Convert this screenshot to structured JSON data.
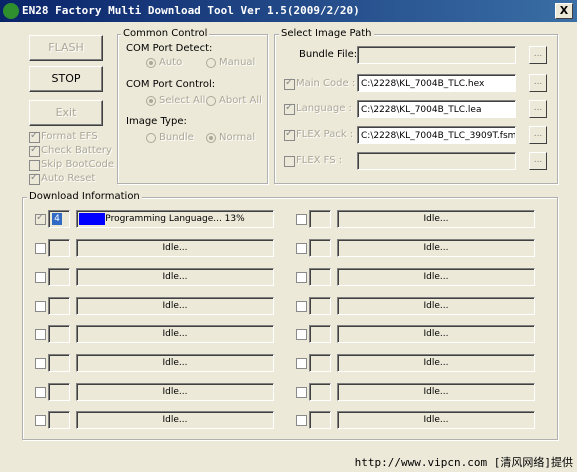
{
  "window": {
    "title": "EN28 Factory Multi Download Tool Ver 1.5(2009/2/20)",
    "close_label": "X"
  },
  "buttons": {
    "flash": "FLASH",
    "stop": "STOP",
    "exit": "Exit"
  },
  "options": [
    {
      "label": "Format EFS",
      "checked": true
    },
    {
      "label": "Check Battery",
      "checked": true
    },
    {
      "label": "Skip BootCode",
      "checked": false
    },
    {
      "label": "Auto Reset",
      "checked": true
    }
  ],
  "common_control": {
    "title": "Common Control",
    "com_port_detect": {
      "label": "COM Port Detect:",
      "auto": "Auto",
      "manual": "Manual"
    },
    "com_port_control": {
      "label": "COM Port Control:",
      "select_all": "Select All",
      "abort_all": "Abort All"
    },
    "image_type": {
      "label": "Image Type:",
      "bundle": "Bundle",
      "normal": "Normal"
    }
  },
  "image_path": {
    "title": "Select Image Path",
    "bundle_label": "Bundle File:",
    "bundle_value": "",
    "browse_label": "...",
    "rows": [
      {
        "label": "Main Code :",
        "value": "C:\\2228\\KL_7004B_TLC.hex",
        "checked": true
      },
      {
        "label": "Language :",
        "value": "C:\\2228\\KL_7004B_TLC.lea",
        "checked": true
      },
      {
        "label": "FLEX Pack :",
        "value": "C:\\2228\\KL_7004B_TLC_3909T.fsm",
        "checked": true
      },
      {
        "label": "FLEX FS :",
        "value": "",
        "checked": false
      }
    ]
  },
  "download": {
    "title": "Download Information",
    "first_id": "4",
    "first_status": "Programming Language...  13%",
    "idle": "Idle..."
  },
  "watermark": "http://www.vipcn.com [清风网络]提供"
}
